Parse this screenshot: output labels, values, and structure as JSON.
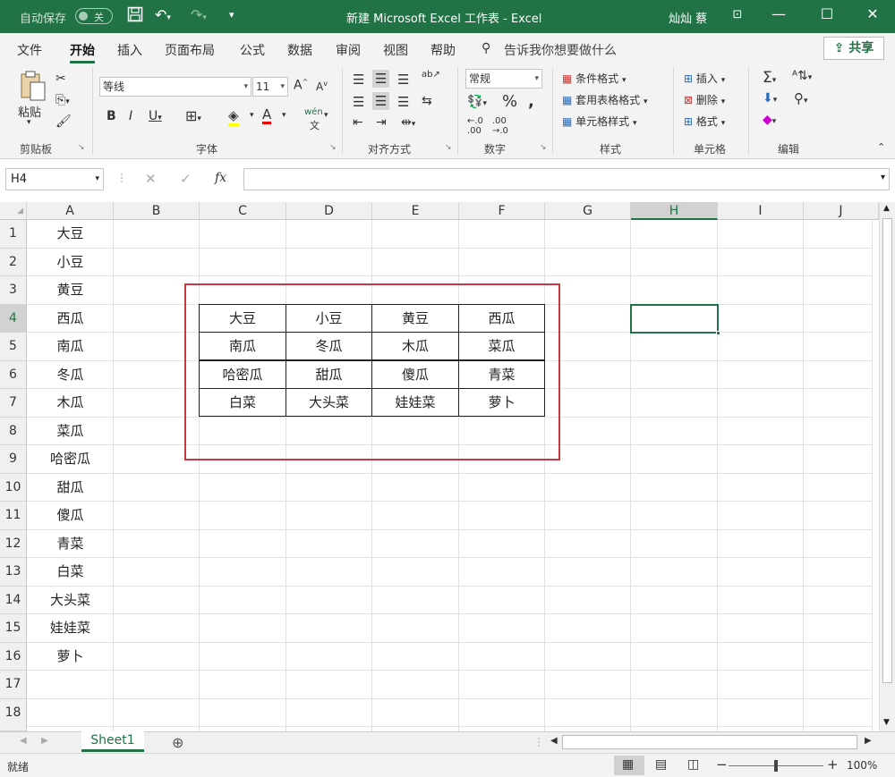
{
  "titlebar": {
    "autosave_label": "自动保存",
    "autosave_state": "关",
    "title": "新建 Microsoft Excel 工作表  -  Excel",
    "user": "灿灿 蔡"
  },
  "tabs": [
    "文件",
    "开始",
    "插入",
    "页面布局",
    "公式",
    "数据",
    "审阅",
    "视图",
    "帮助"
  ],
  "tellme": "告诉我你想要做什么",
  "share_label": "共享",
  "ribbon": {
    "clipboard": {
      "paste": "粘贴",
      "label": "剪贴板"
    },
    "font": {
      "name": "等线",
      "size": "11",
      "label": "字体"
    },
    "alignment": {
      "label": "对齐方式"
    },
    "number": {
      "format": "常规",
      "label": "数字"
    },
    "styles": {
      "conditional": "条件格式",
      "table": "套用表格格式",
      "cell": "单元格样式",
      "label": "样式"
    },
    "cells": {
      "insert": "插入",
      "delete": "删除",
      "format": "格式",
      "label": "单元格"
    },
    "editing": {
      "label": "编辑"
    }
  },
  "formula_bar": {
    "namebox": "H4",
    "fx": "fx",
    "content": ""
  },
  "columns": [
    "A",
    "B",
    "C",
    "D",
    "E",
    "F",
    "G",
    "H",
    "I",
    "J"
  ],
  "selected_column": "H",
  "rows": [
    "1",
    "2",
    "3",
    "4",
    "5",
    "6",
    "7",
    "8",
    "9",
    "10",
    "11",
    "12",
    "13",
    "14",
    "15",
    "16",
    "17",
    "18"
  ],
  "column_a": [
    "大豆",
    "小豆",
    "黄豆",
    "西瓜",
    "南瓜",
    "冬瓜",
    "木瓜",
    "菜瓜",
    "哈密瓜",
    "甜瓜",
    "傻瓜",
    "青菜",
    "白菜",
    "大头菜",
    "娃娃菜",
    "萝卜"
  ],
  "table": [
    [
      "大豆",
      "小豆",
      "黄豆",
      "西瓜"
    ],
    [
      "南瓜",
      "冬瓜",
      "木瓜",
      "菜瓜"
    ],
    [
      "哈密瓜",
      "甜瓜",
      "傻瓜",
      "青菜"
    ],
    [
      "白菜",
      "大头菜",
      "娃娃菜",
      "萝卜"
    ]
  ],
  "sheet_tab": "Sheet1",
  "status": {
    "ready": "就绪",
    "zoom": "100%"
  },
  "colors": {
    "excel_green": "#217346",
    "highlight_red": "#c8393f"
  }
}
